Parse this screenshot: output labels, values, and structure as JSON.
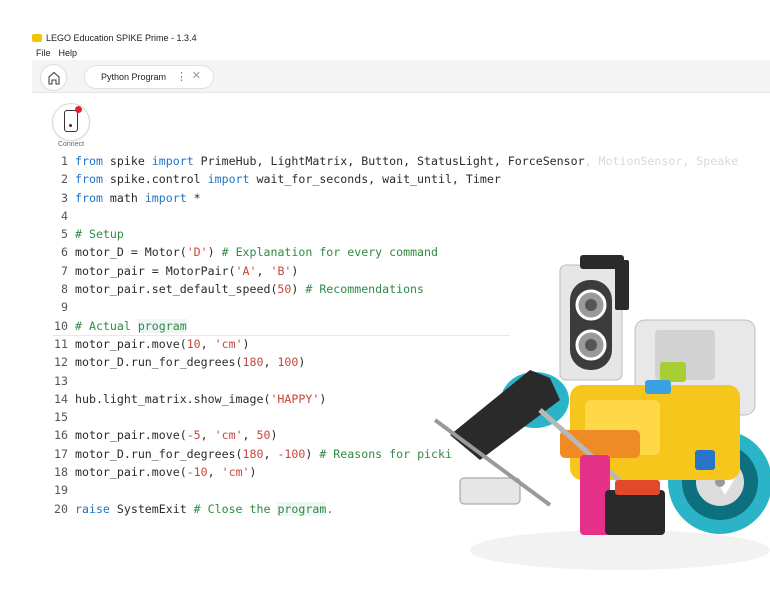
{
  "window": {
    "title": "LEGO Education SPIKE Prime - 1.3.4"
  },
  "menu": [
    "File",
    "Help"
  ],
  "tab": {
    "label": "Python Program"
  },
  "connect": {
    "label": "Connect"
  },
  "code": [
    {
      "n": "1",
      "segs": [
        [
          "kw",
          "from"
        ],
        [
          "t",
          " spike "
        ],
        [
          "kw",
          "import"
        ],
        [
          "t",
          " PrimeHub, LightMatrix, Button, StatusLight, ForceSensor"
        ],
        [
          "faded",
          ", MotionSensor, Speake"
        ]
      ]
    },
    {
      "n": "2",
      "segs": [
        [
          "kw",
          "from"
        ],
        [
          "t",
          " spike.control "
        ],
        [
          "kw",
          "import"
        ],
        [
          "t",
          " wait_for_seconds, wait_until, Timer"
        ]
      ]
    },
    {
      "n": "3",
      "segs": [
        [
          "kw",
          "from"
        ],
        [
          "t",
          " math "
        ],
        [
          "kw",
          "import"
        ],
        [
          "t",
          " *"
        ]
      ]
    },
    {
      "n": "4",
      "segs": []
    },
    {
      "n": "5",
      "segs": [
        [
          "cm",
          "# Setup"
        ]
      ]
    },
    {
      "n": "6",
      "segs": [
        [
          "t",
          "motor_D = Motor("
        ],
        [
          "str",
          "'D'"
        ],
        [
          "t",
          ") "
        ],
        [
          "cm",
          "# Explanation for every command"
        ]
      ]
    },
    {
      "n": "7",
      "segs": [
        [
          "t",
          "motor_pair = MotorPair("
        ],
        [
          "str",
          "'A'"
        ],
        [
          "t",
          ", "
        ],
        [
          "str",
          "'B'"
        ],
        [
          "t",
          ")"
        ]
      ]
    },
    {
      "n": "8",
      "segs": [
        [
          "t",
          "motor_pair.set_default_speed("
        ],
        [
          "num",
          "50"
        ],
        [
          "t",
          ") "
        ],
        [
          "cm",
          "# Recommendations"
        ]
      ]
    },
    {
      "n": "9",
      "segs": []
    },
    {
      "n": "10",
      "segs": [
        [
          "cm",
          "# Actual "
        ],
        [
          "cmhl",
          "program"
        ]
      ],
      "cursor": true
    },
    {
      "n": "11",
      "segs": [
        [
          "t",
          "motor_pair.move("
        ],
        [
          "num",
          "10"
        ],
        [
          "t",
          ", "
        ],
        [
          "str",
          "'cm'"
        ],
        [
          "t",
          ")"
        ]
      ]
    },
    {
      "n": "12",
      "segs": [
        [
          "t",
          "motor_D.run_for_degrees("
        ],
        [
          "num",
          "180"
        ],
        [
          "t",
          ", "
        ],
        [
          "num",
          "100"
        ],
        [
          "t",
          ")"
        ]
      ]
    },
    {
      "n": "13",
      "segs": []
    },
    {
      "n": "14",
      "segs": [
        [
          "t",
          "hub.light_matrix.show_image("
        ],
        [
          "str",
          "'HAPPY'"
        ],
        [
          "t",
          ")"
        ]
      ]
    },
    {
      "n": "15",
      "segs": []
    },
    {
      "n": "16",
      "segs": [
        [
          "t",
          "motor_pair.move("
        ],
        [
          "num",
          "-5"
        ],
        [
          "t",
          ", "
        ],
        [
          "str",
          "'cm'"
        ],
        [
          "t",
          ", "
        ],
        [
          "num",
          "50"
        ],
        [
          "t",
          ")"
        ]
      ]
    },
    {
      "n": "17",
      "segs": [
        [
          "t",
          "motor_D.run_for_degrees("
        ],
        [
          "num",
          "180"
        ],
        [
          "t",
          ", "
        ],
        [
          "num",
          "-100"
        ],
        [
          "t",
          ") "
        ],
        [
          "cm",
          "# Reasons for picki"
        ]
      ]
    },
    {
      "n": "18",
      "segs": [
        [
          "t",
          "motor_pair.move("
        ],
        [
          "num",
          "-10"
        ],
        [
          "t",
          ", "
        ],
        [
          "str",
          "'cm'"
        ],
        [
          "t",
          ")"
        ]
      ]
    },
    {
      "n": "19",
      "segs": []
    },
    {
      "n": "20",
      "segs": [
        [
          "kw",
          "raise"
        ],
        [
          "t",
          " SystemExit "
        ],
        [
          "cm",
          "# Close the "
        ],
        [
          "cmhl",
          "program"
        ],
        [
          "cm",
          "."
        ]
      ]
    }
  ],
  "colors": {
    "keyword": "#1f73c8",
    "comment": "#2f8a43",
    "string": "#c5473a",
    "accent": "#f4c400",
    "robot_teal": "#2bb4c8",
    "robot_yellow": "#f7c61c",
    "robot_magenta": "#e5318a"
  }
}
